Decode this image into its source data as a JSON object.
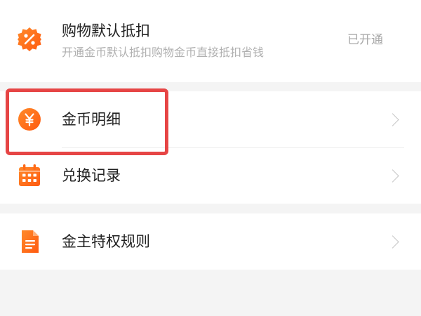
{
  "colors": {
    "accent": "#ff6a17",
    "highlight": "#e64545",
    "background": "#f4f4f4"
  },
  "auto_deduct": {
    "icon": "percent-badge-icon",
    "title": "购物默认抵扣",
    "subtitle": "开通金币默认抵扣购物金币直接抵扣省钱",
    "status": "已开通"
  },
  "menu_group": {
    "items": [
      {
        "icon": "yuan-coin-icon",
        "label": "金币明细"
      },
      {
        "icon": "calendar-icon",
        "label": "兑换记录"
      }
    ]
  },
  "rules": {
    "icon": "document-icon",
    "label": "金主特权规则"
  }
}
